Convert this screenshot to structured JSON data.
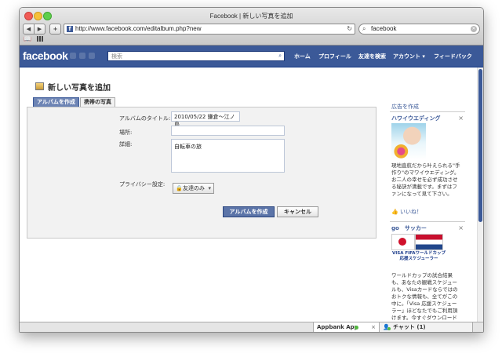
{
  "window": {
    "title": "Facebook | 新しい写真を追加"
  },
  "toolbar": {
    "back": "◀",
    "forward": "▶",
    "add_tab": "+",
    "url": "http://www.facebook.com/editalbum.php?new",
    "reload": "↻",
    "search_value": "facebook"
  },
  "fb": {
    "logo": "facebook",
    "search_placeholder": "検索",
    "nav": [
      "ホーム",
      "プロフィール",
      "友達を検索",
      "アカウント ▾",
      "フィードバック"
    ]
  },
  "page": {
    "title": "新しい写真を追加",
    "tabs": [
      "アルバムを作成",
      "携帯の写真"
    ],
    "form": {
      "album_title_label": "アルバムのタイトル:",
      "album_title_value": "2010/05/22 鎌倉〜江ノ島",
      "location_label": "場所:",
      "location_value": "",
      "description_label": "詳細:",
      "description_value": "自転車の旅",
      "privacy_label": "プライバシー設定:",
      "privacy_value": "友達のみ",
      "create_button": "アルバムを作成",
      "cancel_button": "キャンセル"
    }
  },
  "ads": {
    "header": "広告を作成",
    "ad1": {
      "title": "ハワイウエディング",
      "body": "現地直航だから叶えられる\"手作り\"のマワイウエディング。お二人の幸せを必ず成功させる秘訣が満載です。まずはファンになって見て下さい。",
      "like": "いいね！"
    },
    "ad2": {
      "title": "go　サッカー",
      "banner": "VISA FIFAワールドカップ応援スケジューラー",
      "body": "ワールドカップの試合結果も、あなたの観戦スケジュールも、Visaカードならではのおトクな情報も、全てがこの中に。「Visa 応援スケジューラー」ほどなたでもご利用頂けます。今すぐダウンロード"
    }
  },
  "chat": {
    "app": "Appbank App",
    "chat_label": "チャット (1)"
  },
  "colors": {
    "facebook_blue": "#3b5998",
    "button_blue": "#5b74a8",
    "online_green": "#53b940"
  }
}
